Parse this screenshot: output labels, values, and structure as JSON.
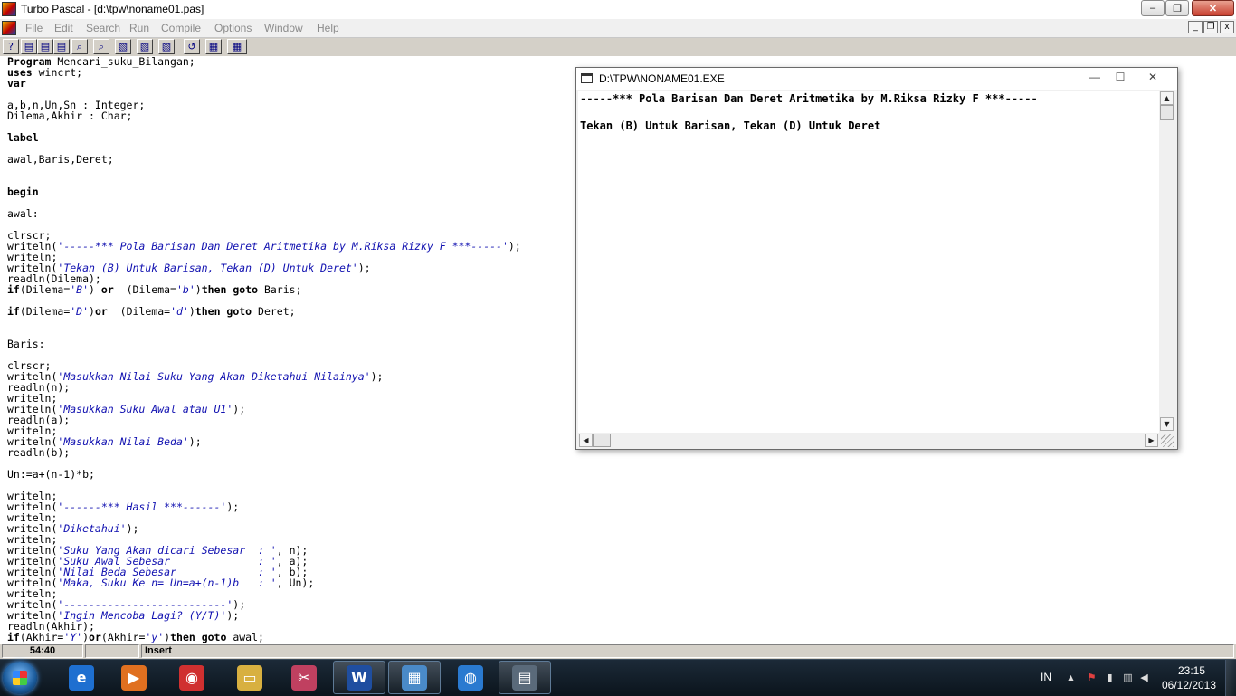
{
  "window": {
    "title": "Turbo Pascal - [d:\\tpw\\noname01.pas]",
    "controls": {
      "minimize": "–",
      "maximize": "❐",
      "close": "✕"
    }
  },
  "menu": {
    "items": [
      "File",
      "Edit",
      "Search",
      "Run",
      "Compile",
      "Options",
      "Window",
      "Help"
    ],
    "mdi_controls": {
      "minimize": "_",
      "restore": "❐",
      "close": "x"
    }
  },
  "toolbar": {
    "buttons": [
      {
        "name": "help-button",
        "icon": "?"
      },
      {
        "name": "open-button",
        "icon": "▤"
      },
      {
        "name": "save-button",
        "icon": "▤"
      },
      {
        "name": "save-as-button",
        "icon": "▤"
      },
      {
        "name": "find-button",
        "icon": "⌕"
      },
      {
        "name": "search-again-button",
        "icon": "⌕"
      },
      {
        "name": "cut-button",
        "icon": "▧"
      },
      {
        "name": "copy-button",
        "icon": "▧"
      },
      {
        "name": "paste-button",
        "icon": "▧"
      },
      {
        "name": "undo-button",
        "icon": "↺"
      },
      {
        "name": "compile-button",
        "icon": "▦"
      },
      {
        "name": "make-button",
        "icon": "▦"
      }
    ]
  },
  "editor": {
    "lines": [
      [
        {
          "t": "Program",
          "k": "kw"
        },
        {
          "t": " Mencari_suku_Bilangan;"
        }
      ],
      [
        {
          "t": "uses",
          "k": "kw"
        },
        {
          "t": " wincrt;"
        }
      ],
      [
        {
          "t": "var",
          "k": "kw"
        }
      ],
      [],
      [
        {
          "t": "a,b,n,Un,Sn : Integer;"
        }
      ],
      [
        {
          "t": "Dilema,Akhir : Char;"
        }
      ],
      [],
      [
        {
          "t": "label",
          "k": "kw"
        }
      ],
      [],
      [
        {
          "t": "awal,Baris,Deret;"
        }
      ],
      [],
      [],
      [
        {
          "t": "begin",
          "k": "kw"
        }
      ],
      [],
      [
        {
          "t": "awal:"
        }
      ],
      [],
      [
        {
          "t": "clrscr;"
        }
      ],
      [
        {
          "t": "writeln("
        },
        {
          "t": "'-----*** Pola Barisan Dan Deret Aritmetika by M.Riksa Rizky F ***-----'",
          "k": "str"
        },
        {
          "t": ");"
        }
      ],
      [
        {
          "t": "writeln;"
        }
      ],
      [
        {
          "t": "writeln("
        },
        {
          "t": "'Tekan (B) Untuk Barisan, Tekan (D) Untuk Deret'",
          "k": "str"
        },
        {
          "t": ");"
        }
      ],
      [
        {
          "t": "readln(Dilema);"
        }
      ],
      [
        {
          "t": "if",
          "k": "kw"
        },
        {
          "t": "(Dilema="
        },
        {
          "t": "'B'",
          "k": "str"
        },
        {
          "t": ") "
        },
        {
          "t": "or",
          "k": "kw"
        },
        {
          "t": "  (Dilema="
        },
        {
          "t": "'b'",
          "k": "str"
        },
        {
          "t": ")"
        },
        {
          "t": "then goto",
          "k": "kw"
        },
        {
          "t": " Baris;"
        }
      ],
      [],
      [
        {
          "t": "if",
          "k": "kw"
        },
        {
          "t": "(Dilema="
        },
        {
          "t": "'D'",
          "k": "str"
        },
        {
          "t": ")"
        },
        {
          "t": "or",
          "k": "kw"
        },
        {
          "t": "  (Dilema="
        },
        {
          "t": "'d'",
          "k": "str"
        },
        {
          "t": ")"
        },
        {
          "t": "then goto",
          "k": "kw"
        },
        {
          "t": " Deret;"
        }
      ],
      [],
      [],
      [
        {
          "t": "Baris:"
        }
      ],
      [],
      [
        {
          "t": "clrscr;"
        }
      ],
      [
        {
          "t": "writeln("
        },
        {
          "t": "'Masukkan Nilai Suku Yang Akan Diketahui Nilainya'",
          "k": "str"
        },
        {
          "t": ");"
        }
      ],
      [
        {
          "t": "readln(n);"
        }
      ],
      [
        {
          "t": "writeln;"
        }
      ],
      [
        {
          "t": "writeln("
        },
        {
          "t": "'Masukkan Suku Awal atau U1'",
          "k": "str"
        },
        {
          "t": ");"
        }
      ],
      [
        {
          "t": "readln(a);"
        }
      ],
      [
        {
          "t": "writeln;"
        }
      ],
      [
        {
          "t": "writeln("
        },
        {
          "t": "'Masukkan Nilai Beda'",
          "k": "str"
        },
        {
          "t": ");"
        }
      ],
      [
        {
          "t": "readln(b);"
        }
      ],
      [],
      [
        {
          "t": "Un:=a+(n-1)*b;"
        }
      ],
      [],
      [
        {
          "t": "writeln;"
        }
      ],
      [
        {
          "t": "writeln("
        },
        {
          "t": "'------*** Hasil ***------'",
          "k": "str"
        },
        {
          "t": ");"
        }
      ],
      [
        {
          "t": "writeln;"
        }
      ],
      [
        {
          "t": "writeln("
        },
        {
          "t": "'Diketahui'",
          "k": "str"
        },
        {
          "t": ");"
        }
      ],
      [
        {
          "t": "writeln;"
        }
      ],
      [
        {
          "t": "writeln("
        },
        {
          "t": "'Suku Yang Akan dicari Sebesar  : '",
          "k": "str"
        },
        {
          "t": ", n);"
        }
      ],
      [
        {
          "t": "writeln("
        },
        {
          "t": "'Suku Awal Sebesar              : '",
          "k": "str"
        },
        {
          "t": ", a);"
        }
      ],
      [
        {
          "t": "writeln("
        },
        {
          "t": "'Nilai Beda Sebesar             : '",
          "k": "str"
        },
        {
          "t": ", b);"
        }
      ],
      [
        {
          "t": "writeln("
        },
        {
          "t": "'Maka, Suku Ke n= Un=a+(n-1)b   : '",
          "k": "str"
        },
        {
          "t": ", Un);"
        }
      ],
      [
        {
          "t": "writeln;"
        }
      ],
      [
        {
          "t": "writeln("
        },
        {
          "t": "'--------------------------'",
          "k": "str"
        },
        {
          "t": ");"
        }
      ],
      [
        {
          "t": "writeln("
        },
        {
          "t": "'Ingin Mencoba Lagi? (Y/T)'",
          "k": "str"
        },
        {
          "t": ");"
        }
      ],
      [
        {
          "t": "readln(Akhir);"
        }
      ],
      [
        {
          "t": "if",
          "k": "kw"
        },
        {
          "t": "(Akhir="
        },
        {
          "t": "'Y'",
          "k": "str"
        },
        {
          "t": ")"
        },
        {
          "t": "or",
          "k": "kw"
        },
        {
          "t": "(Akhir="
        },
        {
          "t": "'y'",
          "k": "str"
        },
        {
          "t": ")"
        },
        {
          "t": "then goto",
          "k": "kw"
        },
        {
          "t": " awal;"
        }
      ]
    ]
  },
  "status": {
    "position": "54:40",
    "modified": "",
    "mode": "Insert"
  },
  "console": {
    "title": "D:\\TPW\\NONAME01.EXE",
    "controls": {
      "minimize": "—",
      "maximize": "☐",
      "close": "✕"
    },
    "lines": [
      "-----*** Pola Barisan Dan Deret Aritmetika by M.Riksa Rizky F ***-----",
      "",
      "Tekan (B) Untuk Barisan, Tekan (D) Untuk Deret"
    ],
    "scroll": {
      "up": "▲",
      "down": "▼",
      "left": "◀",
      "right": "▶"
    }
  },
  "taskbar": {
    "apps": [
      {
        "name": "ie-app",
        "glyph": "e",
        "color": "#1e6fd0",
        "active": false
      },
      {
        "name": "media-player-app",
        "glyph": "▶",
        "color": "#e07020",
        "active": false
      },
      {
        "name": "chrome-app",
        "glyph": "◉",
        "color": "#d03030",
        "active": false
      },
      {
        "name": "explorer-app",
        "glyph": "▭",
        "color": "#d8b040",
        "active": false
      },
      {
        "name": "snipping-app",
        "glyph": "✂",
        "color": "#c04060",
        "active": false
      },
      {
        "name": "word-app",
        "glyph": "W",
        "color": "#1f4ea0",
        "active": true
      },
      {
        "name": "network-app",
        "glyph": "▦",
        "color": "#4a8ac8",
        "active": true
      },
      {
        "name": "globe-app",
        "glyph": "◍",
        "color": "#2a7ad0",
        "active": false
      },
      {
        "name": "turbo-pascal-app",
        "glyph": "▤",
        "color": "#5a6a7a",
        "active": true
      }
    ],
    "tray": {
      "language": "IN",
      "time": "23:15",
      "date": "06/12/2013",
      "icons": [
        {
          "name": "show-hidden-icon",
          "glyph": "▲"
        },
        {
          "name": "flag-icon",
          "glyph": "⚑"
        },
        {
          "name": "power-icon",
          "glyph": "▮"
        },
        {
          "name": "network-icon",
          "glyph": "▥"
        },
        {
          "name": "volume-icon",
          "glyph": "◀"
        }
      ]
    }
  }
}
